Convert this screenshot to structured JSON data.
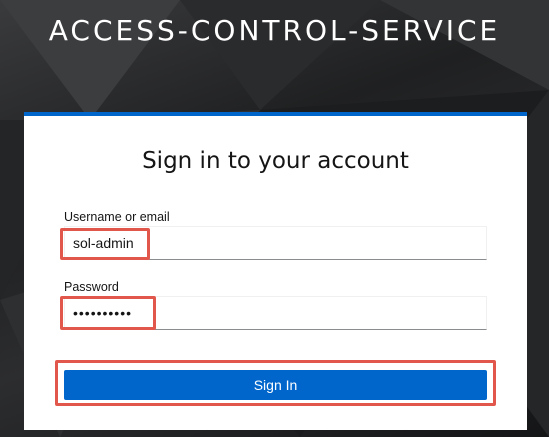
{
  "header": {
    "realm_title": "ACCESS-CONTROL-SERVICE"
  },
  "login": {
    "title": "Sign in to your account",
    "username_label": "Username or email",
    "username_value": "sol-admin",
    "password_label": "Password",
    "password_value": "••••••••••",
    "submit_label": "Sign In"
  },
  "colors": {
    "accent": "#0066cc",
    "highlight": "#e2574c",
    "background": "#2b2d2f"
  }
}
